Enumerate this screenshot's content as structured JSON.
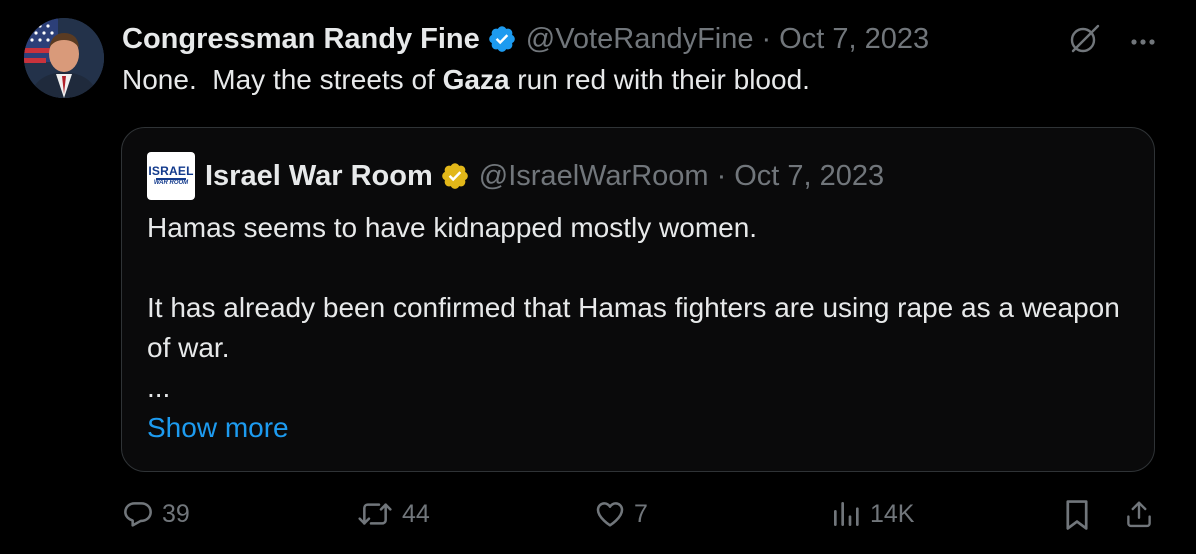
{
  "tweet": {
    "author_name": "Congressman Randy Fine",
    "handle": "@VoteRandyFine",
    "separator": "·",
    "date": "Oct 7, 2023",
    "text_before": "None.  May the streets of ",
    "text_bold": "Gaza",
    "text_after": " run red with their blood."
  },
  "quote": {
    "logo_line1": "ISRAEL",
    "logo_line2": "WAR ROOM",
    "author_name": "Israel War Room",
    "handle": "@IsraelWarRoom",
    "separator": "·",
    "date": "Oct 7, 2023",
    "line1": "Hamas seems to have kidnapped mostly women.",
    "line2": "It has already been confirmed that Hamas fighters are using rape as a weapon of war.",
    "ellipsis": "...",
    "show_more": "Show more"
  },
  "actions": {
    "replies": "39",
    "reposts": "44",
    "likes": "7",
    "views": "14K"
  },
  "colors": {
    "background": "#000000",
    "text": "#e7e9ea",
    "muted": "#71767b",
    "accent": "#1d9bf0",
    "verified_blue": "#1d9bf0",
    "verified_gold": "#e2b719",
    "border": "#2f3336"
  },
  "icons": {
    "header_right": [
      "grok-icon",
      "more-icon"
    ],
    "action_bar": [
      "reply-icon",
      "repost-icon",
      "like-icon",
      "views-icon",
      "bookmark-icon",
      "share-icon"
    ]
  }
}
